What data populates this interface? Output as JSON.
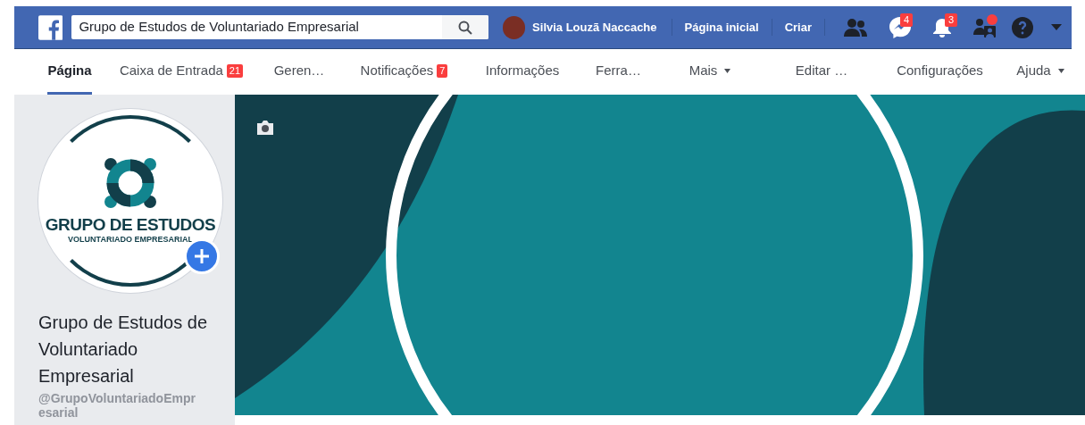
{
  "top_bar": {
    "search": {
      "value": "Grupo de Estudos de Voluntariado Empresarial"
    },
    "user_name": "Silvia Louzã Naccache",
    "links": [
      "Página inicial",
      "Criar"
    ],
    "icons": [
      {
        "kind": "friends",
        "dot": false
      },
      {
        "kind": "messenger",
        "badge": "4",
        "dot": false
      },
      {
        "kind": "bell",
        "badge": "3",
        "dot": false
      },
      {
        "kind": "groups",
        "dot": true
      },
      {
        "kind": "help",
        "dot": false
      },
      {
        "kind": "caret",
        "dot": false
      }
    ]
  },
  "tabs": [
    {
      "label": "Página",
      "selected": true,
      "has_menu": false
    },
    {
      "label": "Caixa de Entrada",
      "selected": false,
      "badge": "21",
      "has_menu": false
    },
    {
      "label": "Geren…",
      "selected": false,
      "has_menu": false
    },
    {
      "label": "Notificações",
      "selected": false,
      "badge": "7",
      "has_menu": false
    },
    {
      "label": "Informações",
      "selected": false,
      "has_menu": false
    },
    {
      "label": "Ferra…",
      "selected": false,
      "has_menu": false
    },
    {
      "label": "Mais",
      "selected": false,
      "has_menu": true
    },
    {
      "label": "Editar …",
      "selected": false,
      "has_menu": false
    },
    {
      "label": "Configurações",
      "selected": false,
      "has_menu": false
    },
    {
      "label": "Ajuda",
      "selected": false,
      "has_menu": true
    }
  ],
  "profile": {
    "logo_title": "GRUPO DE ESTUDOS",
    "logo_subtitle": "VOLUNTARIADO EMPRESARIAL",
    "page_name": "Grupo de Estudos de Voluntariado Empresarial",
    "handle": "@GrupoVoluntariadoEmpr esarial"
  }
}
